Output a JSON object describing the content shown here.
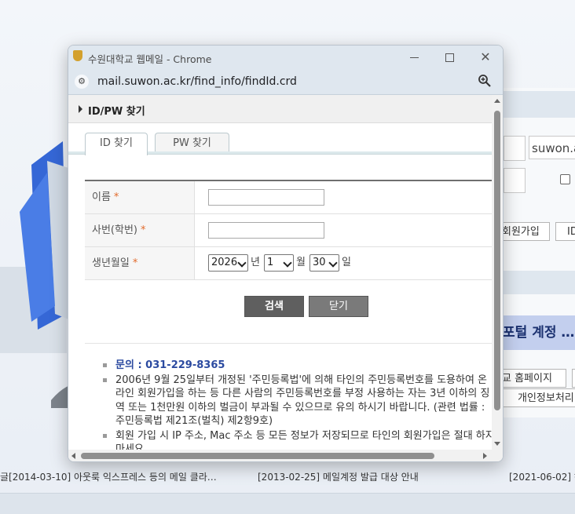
{
  "window": {
    "title": "수원대학교 웹메일 - Chrome",
    "url": "mail.suwon.ac.kr/find_info/findId.crd",
    "accent": "#dfe7ef"
  },
  "page": {
    "section_title": "ID/PW 찾기",
    "tabs": [
      {
        "label": "ID 찾기",
        "active": true
      },
      {
        "label": "PW 찾기",
        "active": false
      }
    ],
    "form": {
      "name_label": "이름",
      "id_label": "사번(학번)",
      "birth_label": "생년월일",
      "required_mark": "*",
      "name_value": "",
      "id_value": "",
      "birth_year": "2026",
      "birth_month": "1",
      "birth_day": "30",
      "year_unit": "년",
      "month_unit": "월",
      "day_unit": "일"
    },
    "buttons": {
      "search": "검색",
      "close": "닫기"
    },
    "notes": {
      "contact": "문의 : 031-229-8365",
      "note1": "2006년 9월 25일부터 개정된 '주민등록법'에 의해 타인의 주민등록번호를 도용하여 온라인 회원가입을 하는 등 다른 사람의 주민등록번호를 부정 사용하는 자는 3년 이하의 징역 또는 1천만원 이하의 벌금이 부과될 수 있으므로 유의 하시기 바랍니다. (관련 법률 : 주민등록법 제21조(벌칙) 제2항9호)",
      "note2": "회원 가입 시 IP 주소, Mac 주소 등 모든 정보가 저장되므로 타인의 회원가입은 절대 하지 마세요."
    }
  },
  "background": {
    "domain_input": "suwon.a",
    "signup_button": "회원가입",
    "id_button": "ID",
    "banner": "포털 계정 …",
    "homepage_button": "교 홈페이지",
    "privacy_button": "개인정보처리",
    "news": [
      "글[2014-03-10] 아웃룩 익스프레스 등의 메일 클라…",
      "[2013-02-25] 메일계정 발급 대상 안내",
      "[2021-06-02] 해"
    ]
  }
}
